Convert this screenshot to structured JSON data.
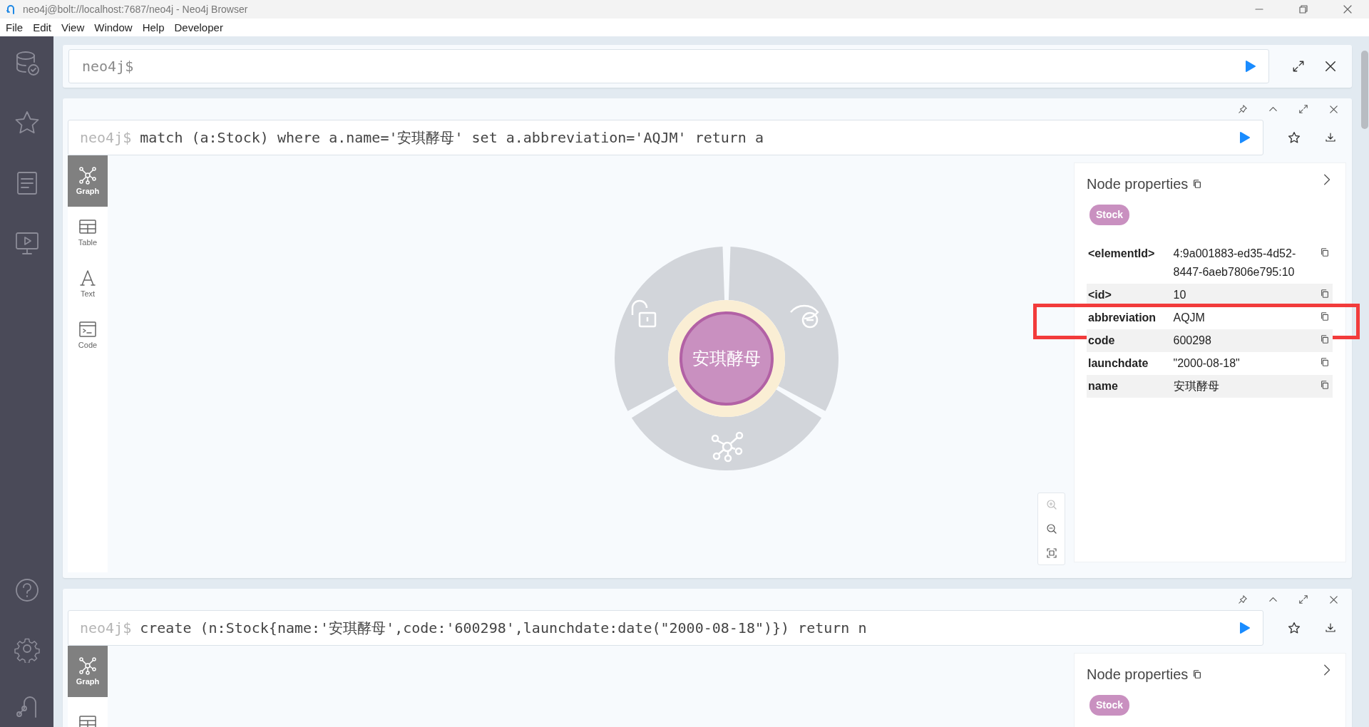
{
  "window": {
    "title": "neo4j@bolt://localhost:7687/neo4j - Neo4j Browser"
  },
  "menu": [
    "File",
    "Edit",
    "View",
    "Window",
    "Help",
    "Developer"
  ],
  "editor": {
    "placeholder": "neo4j$"
  },
  "frames": [
    {
      "prompt": "neo4j$",
      "query": "match (a:Stock) where a.name='安琪酵母' set a.abbreviation='AQJM' return a",
      "views": [
        {
          "kind": "graph",
          "label": "Graph",
          "selected": true
        },
        {
          "kind": "table",
          "label": "Table",
          "selected": false
        },
        {
          "kind": "text",
          "label": "Text",
          "selected": false
        },
        {
          "kind": "code",
          "label": "Code",
          "selected": false
        }
      ],
      "node": {
        "caption": "安琪酵母"
      },
      "panel": {
        "title": "Node properties",
        "labels": [
          "Stock"
        ],
        "properties": [
          {
            "key": "<elementId>",
            "value": "4:9a001883-ed35-4d52-8447-6aeb7806e795:10",
            "highlighted": false
          },
          {
            "key": "<id>",
            "value": "10",
            "highlighted": false
          },
          {
            "key": "abbreviation",
            "value": "AQJM",
            "highlighted": true
          },
          {
            "key": "code",
            "value": "600298",
            "highlighted": false
          },
          {
            "key": "launchdate",
            "value": "\"2000-08-18\"",
            "highlighted": false
          },
          {
            "key": "name",
            "value": "安琪酵母",
            "highlighted": false
          }
        ]
      }
    },
    {
      "prompt": "neo4j$",
      "query": "create (n:Stock{name:'安琪酵母',code:'600298',launchdate:date(\"2000-08-18\")}) return n",
      "views": [
        {
          "kind": "graph",
          "label": "Graph",
          "selected": true
        },
        {
          "kind": "table",
          "selected": false
        }
      ],
      "panel": {
        "title": "Node properties",
        "labels": [
          "Stock"
        ]
      }
    }
  ]
}
